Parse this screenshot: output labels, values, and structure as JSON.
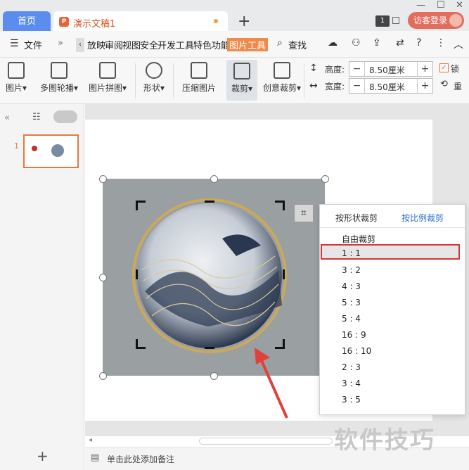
{
  "tabs": {
    "home": "首页",
    "doc": "演示文稿1"
  },
  "titlebar": {
    "badge": "1",
    "visitor": "访客登录"
  },
  "menubar": {
    "file": "文件",
    "items": [
      "放映",
      "审阅",
      "视图",
      "安全",
      "开发工具",
      "特色功能"
    ],
    "active": "图片工具",
    "search": "查找"
  },
  "toolbar": {
    "img_add": "图片",
    "multi": "多图轮播",
    "collage": "图片拼图",
    "shape": "形状",
    "compress": "压缩图片",
    "crop": "裁剪",
    "creative": "创意裁剪",
    "height_label": "高度:",
    "width_label": "宽度:",
    "height_value": "8.50厘米",
    "width_value": "8.50厘米",
    "lock": "锁",
    "reset": "重"
  },
  "slides": {
    "number": "1"
  },
  "crop_menu": {
    "tab_shape": "按形状裁剪",
    "tab_ratio": "按比例裁剪",
    "options": [
      "自由裁剪",
      "1 : 1",
      "3 : 2",
      "4 : 3",
      "5 : 3",
      "5 : 4",
      "16 : 9",
      "16 : 10",
      "2 : 3",
      "3 : 4",
      "3 : 5"
    ],
    "selected": "1 : 1"
  },
  "notes": {
    "placeholder": "单击此处添加备注"
  },
  "watermark": "软件技巧",
  "colors": {
    "accent": "#5b8def",
    "tool_tab": "#f08a4b",
    "highlight_border": "#d9353a",
    "arrow": "#e2403a"
  }
}
